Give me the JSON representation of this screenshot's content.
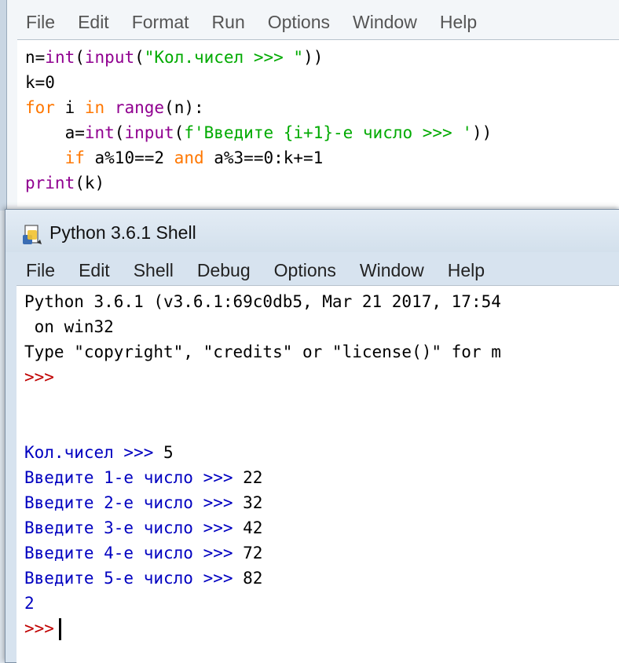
{
  "editor": {
    "menu": [
      "File",
      "Edit",
      "Format",
      "Run",
      "Options",
      "Window",
      "Help"
    ],
    "code": [
      [
        {
          "t": "n=",
          "c": "blk"
        },
        {
          "t": "int",
          "c": "bi"
        },
        {
          "t": "(",
          "c": "blk"
        },
        {
          "t": "input",
          "c": "bi"
        },
        {
          "t": "(",
          "c": "blk"
        },
        {
          "t": "\"Кол.чисел >>> \"",
          "c": "str"
        },
        {
          "t": "))",
          "c": "blk"
        }
      ],
      [
        {
          "t": "k=0",
          "c": "blk"
        }
      ],
      [
        {
          "t": "for",
          "c": "kw"
        },
        {
          "t": " i ",
          "c": "blk"
        },
        {
          "t": "in",
          "c": "kw"
        },
        {
          "t": " ",
          "c": "blk"
        },
        {
          "t": "range",
          "c": "bi"
        },
        {
          "t": "(n):",
          "c": "blk"
        }
      ],
      [
        {
          "t": "    a=",
          "c": "blk"
        },
        {
          "t": "int",
          "c": "bi"
        },
        {
          "t": "(",
          "c": "blk"
        },
        {
          "t": "input",
          "c": "bi"
        },
        {
          "t": "(",
          "c": "blk"
        },
        {
          "t": "f'Введите {i+1}-е число >>> '",
          "c": "str"
        },
        {
          "t": "))",
          "c": "blk"
        }
      ],
      [
        {
          "t": "    ",
          "c": "blk"
        },
        {
          "t": "if",
          "c": "kw"
        },
        {
          "t": " a%10==2 ",
          "c": "blk"
        },
        {
          "t": "and",
          "c": "kw"
        },
        {
          "t": " a%3==0:k+=1",
          "c": "blk"
        }
      ],
      [
        {
          "t": "print",
          "c": "bi"
        },
        {
          "t": "(k)",
          "c": "blk"
        }
      ]
    ]
  },
  "shell": {
    "title": "Python 3.6.1 Shell",
    "menu": [
      "File",
      "Edit",
      "Shell",
      "Debug",
      "Options",
      "Window",
      "Help"
    ],
    "output": [
      [
        {
          "t": "Python 3.6.1 (v3.6.1:69c0db5, Mar 21 2017, 17:54",
          "c": "sout"
        }
      ],
      [
        {
          "t": " on win32",
          "c": "sout"
        }
      ],
      [
        {
          "t": "Type \"copyright\", \"credits\" or \"license()\" for m",
          "c": "sout"
        }
      ],
      [
        {
          "t": ">>>",
          "c": "prompt"
        }
      ],
      [],
      [],
      [
        {
          "t": "Кол.чисел >>> ",
          "c": "stdout"
        },
        {
          "t": "5",
          "c": "inp"
        }
      ],
      [
        {
          "t": "Введите 1-е число >>> ",
          "c": "stdout"
        },
        {
          "t": "22",
          "c": "inp"
        }
      ],
      [
        {
          "t": "Введите 2-е число >>> ",
          "c": "stdout"
        },
        {
          "t": "32",
          "c": "inp"
        }
      ],
      [
        {
          "t": "Введите 3-е число >>> ",
          "c": "stdout"
        },
        {
          "t": "42",
          "c": "inp"
        }
      ],
      [
        {
          "t": "Введите 4-е число >>> ",
          "c": "stdout"
        },
        {
          "t": "72",
          "c": "inp"
        }
      ],
      [
        {
          "t": "Введите 5-е число >>> ",
          "c": "stdout"
        },
        {
          "t": "82",
          "c": "inp"
        }
      ],
      [
        {
          "t": "2",
          "c": "stdout"
        }
      ],
      [
        {
          "t": ">>>",
          "c": "prompt"
        }
      ]
    ]
  }
}
